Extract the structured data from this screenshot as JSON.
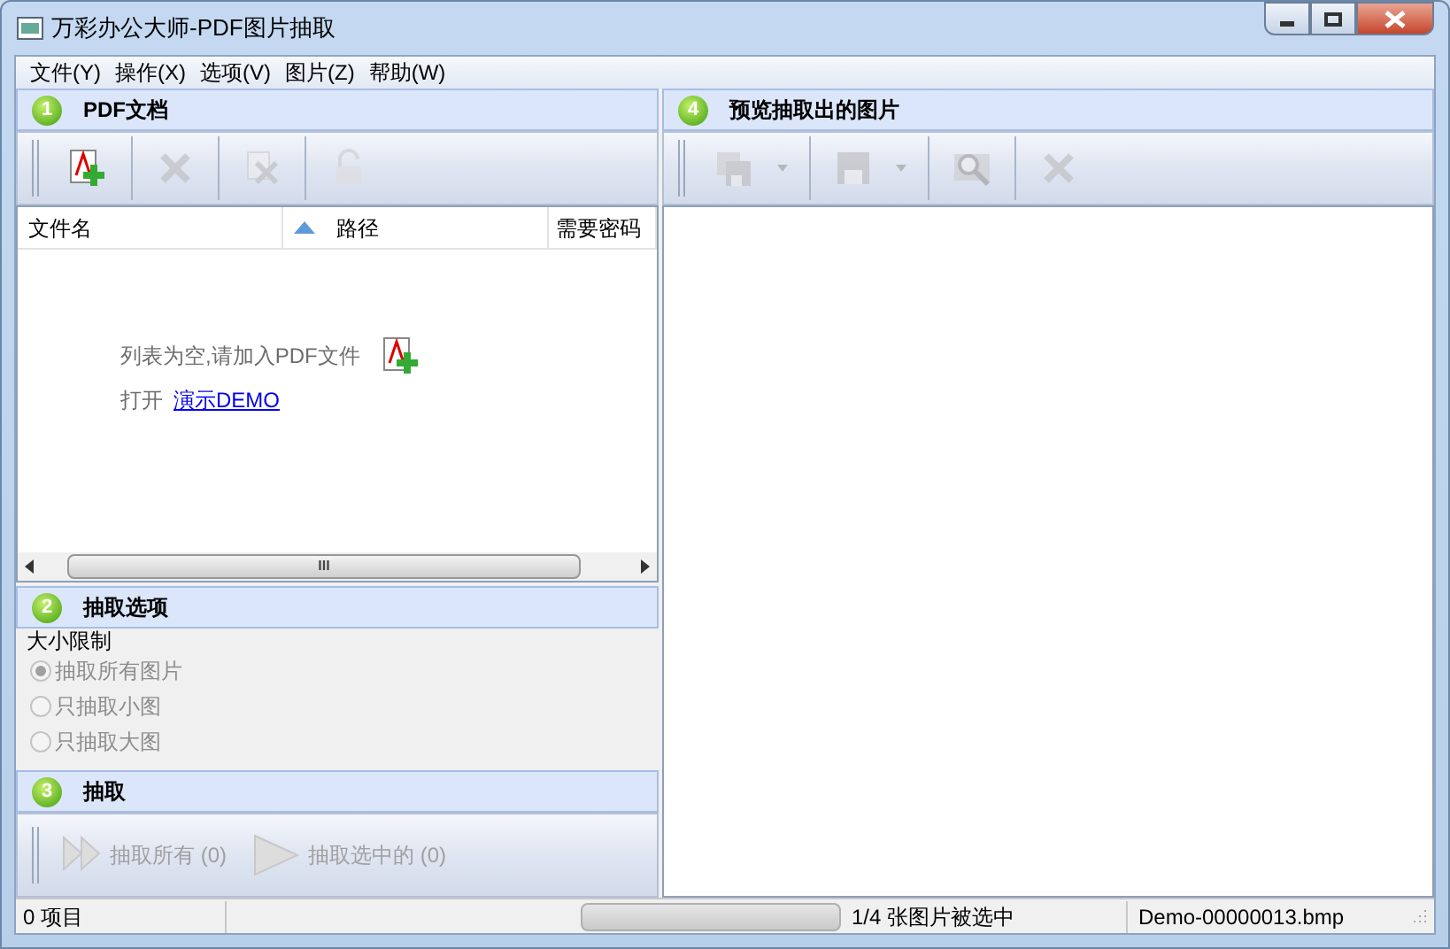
{
  "window": {
    "title": "万彩办公大师-PDF图片抽取"
  },
  "menu": [
    "文件(Y)",
    "操作(X)",
    "选项(V)",
    "图片(Z)",
    "帮助(W)"
  ],
  "pdf_panel": {
    "number": "1",
    "title": "PDF文档",
    "toolbar": [
      {
        "kind": "add-pdf",
        "disabled": false
      },
      {
        "kind": "delete",
        "disabled": true
      },
      {
        "kind": "delete-file",
        "disabled": true
      },
      {
        "kind": "lock",
        "disabled": true
      }
    ],
    "columns": [
      "文件名",
      "路径",
      "需要密码"
    ],
    "empty_message": "列表为空,请加入PDF文件",
    "open_label": "打开",
    "demo_link": "演示DEMO",
    "scrollbar_grip": "III"
  },
  "options_panel": {
    "number": "2",
    "title": "抽取选项",
    "group": "大小限制",
    "radios": [
      {
        "label": "抽取所有图片",
        "selected": true,
        "disabled": true
      },
      {
        "label": "只抽取小图",
        "selected": false,
        "disabled": true
      },
      {
        "label": "只抽取大图",
        "selected": false,
        "disabled": true
      }
    ]
  },
  "extract_panel": {
    "number": "3",
    "title": "抽取",
    "buttons": [
      {
        "kind": "extract-all",
        "label": "抽取所有 (0)",
        "disabled": true
      },
      {
        "kind": "extract-selected",
        "label": "抽取选中的 (0)",
        "disabled": true
      }
    ]
  },
  "preview_panel": {
    "number": "4",
    "title": "预览抽取出的图片",
    "toolbar": [
      {
        "kind": "save-all",
        "disabled": true
      },
      {
        "kind": "save",
        "disabled": true
      },
      {
        "kind": "zoom",
        "disabled": true
      },
      {
        "kind": "delete",
        "disabled": true
      }
    ]
  },
  "status_bar": {
    "items": "0 项目",
    "progress": {
      "level": 0
    },
    "selection": "1/4 张图片被选中",
    "file": "Demo-00000013.bmp"
  }
}
